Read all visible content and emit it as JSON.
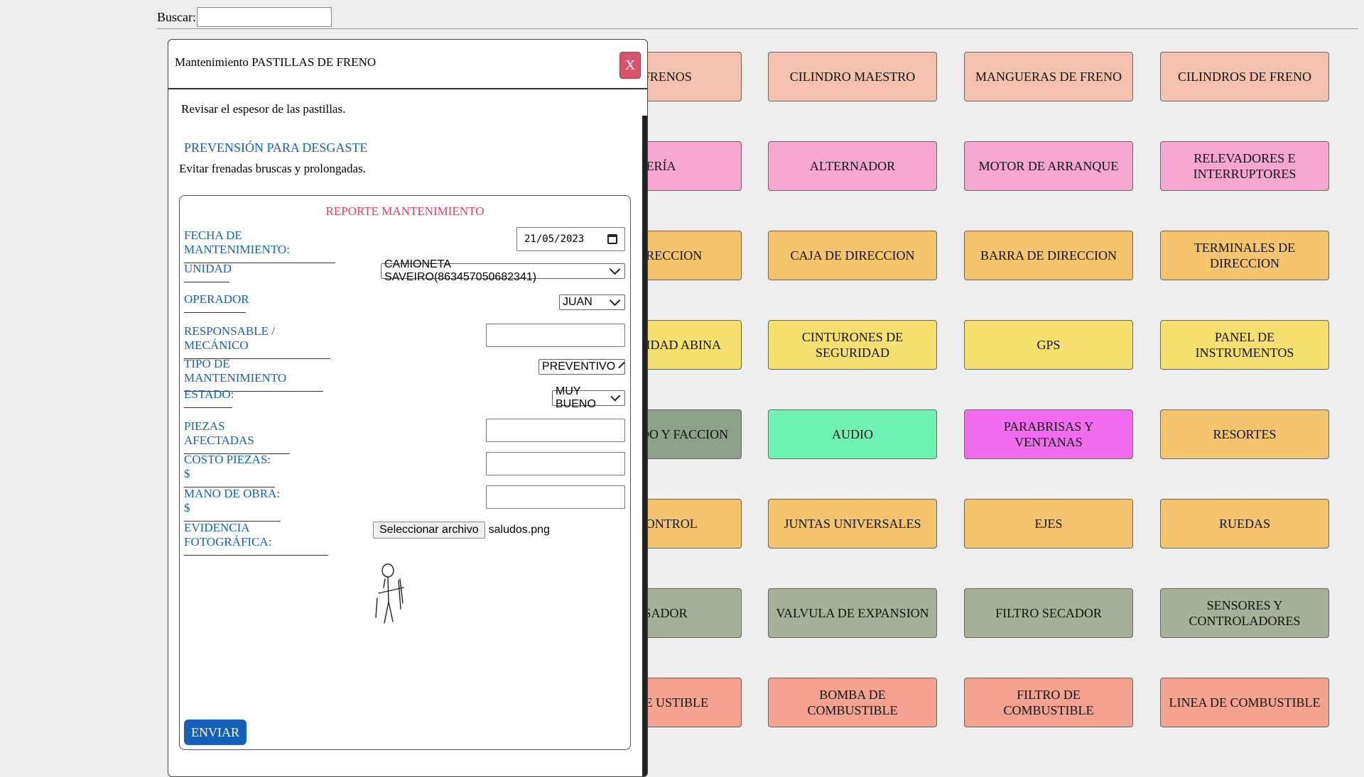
{
  "search": {
    "label": "Buscar:",
    "value": ""
  },
  "tiles": [
    {
      "label": "DE FRENOS",
      "color": "#f5c3ad"
    },
    {
      "label": "CILINDRO MAESTRO",
      "color": "#f5c3ad"
    },
    {
      "label": "MANGUERAS DE FRENO",
      "color": "#f5c3ad"
    },
    {
      "label": "CILINDROS DE FRENO",
      "color": "#f5c3ad"
    },
    {
      "label": "TERÍA",
      "color": "#f4a7cf"
    },
    {
      "label": "ALTERNADOR",
      "color": "#f4a7cf"
    },
    {
      "label": "MOTOR DE ARRANQUE",
      "color": "#f4a7cf"
    },
    {
      "label": "RELEVADORES E INTERRUPTORES",
      "color": "#f4a7cf"
    },
    {
      "label": "DE DIRECCION",
      "color": "#f5c46e"
    },
    {
      "label": "CAJA DE DIRECCION",
      "color": "#f5c46e"
    },
    {
      "label": "BARRA DE DIRECCION",
      "color": "#f5c46e"
    },
    {
      "label": "TERMINALES DE DIRECCION",
      "color": "#f5c46e"
    },
    {
      "label": "E SEGURIDAD ABINA",
      "color": "#f5e070"
    },
    {
      "label": "CINTURONES DE SEGURIDAD",
      "color": "#f5e070"
    },
    {
      "label": "GPS",
      "color": "#f5e070"
    },
    {
      "label": "PANEL DE INSTRUMENTOS",
      "color": "#f5e070"
    },
    {
      "label": "DICIONADO Y FACCION",
      "color": "#8fa08c"
    },
    {
      "label": "AUDIO",
      "color": "#6ff2b4"
    },
    {
      "label": "PARABRISAS Y VENTANAS",
      "color": "#f26cf0"
    },
    {
      "label": "RESORTES",
      "color": "#f5c46e"
    },
    {
      "label": "DE CONTROL",
      "color": "#f5c46e"
    },
    {
      "label": "JUNTAS UNIVERSALES",
      "color": "#f5c46e"
    },
    {
      "label": "EJES",
      "color": "#f5c46e"
    },
    {
      "label": "RUEDAS",
      "color": "#f5c46e"
    },
    {
      "label": "ENSADOR",
      "color": "#a3b298"
    },
    {
      "label": "VALVULA DE EXPANSION",
      "color": "#a3b298"
    },
    {
      "label": "FILTRO SECADOR",
      "color": "#a3b298"
    },
    {
      "label": "SENSORES Y CONTROLADORES",
      "color": "#a3b298"
    },
    {
      "label": "QUE DE USTIBLE",
      "color": "#f5a391"
    },
    {
      "label": "BOMBA DE COMBUSTIBLE",
      "color": "#f5a391"
    },
    {
      "label": "FILTRO DE COMBUSTIBLE",
      "color": "#f5a391"
    },
    {
      "label": "LINEA DE COMBUSTIBLE",
      "color": "#f5a391"
    }
  ],
  "modal": {
    "title": "Mantenimiento PASTILLAS DE FRENO",
    "close_label": "X",
    "description": "Revisar el espesor de las pastillas.",
    "prevention_title": "PREVENSIÓN PARA DESGASTE",
    "prevention_text": "Evitar frenadas bruscas y prolongadas.",
    "report": {
      "title": "REPORTE MANTENIMIENTO",
      "fecha_label": "FECHA DE MANTENIMIENTO:",
      "fecha_value": "21/05/2023",
      "unidad_label": "UNIDAD",
      "unidad_value": "CAMIONETA SAVEIRO(863457050682341)",
      "operador_label": "OPERADOR",
      "operador_value": "JUAN",
      "responsable_label": "RESPONSABLE / MECÁNICO",
      "responsable_value": "",
      "tipo_label": "TIPO DE MANTENIMIENTO",
      "tipo_value": "PREVENTIVO",
      "estado_label": "ESTADO:",
      "estado_value": "MUY BUENO",
      "piezas_label": "PIEZAS AFECTADAS",
      "piezas_value": "",
      "costo_label": "COSTO PIEZAS: $",
      "costo_value": "",
      "mano_label": "MANO DE OBRA: $",
      "mano_value": "",
      "evidencia_label": "EVIDENCIA FOTOGRÁFICA:",
      "file_button": "Seleccionar archivo",
      "file_name": "saludos.png",
      "send_label": "ENVIAR"
    }
  },
  "colors": {
    "accent_blue": "#1561b8",
    "report_title": "#e0405e",
    "close_button": "#d9546a"
  }
}
